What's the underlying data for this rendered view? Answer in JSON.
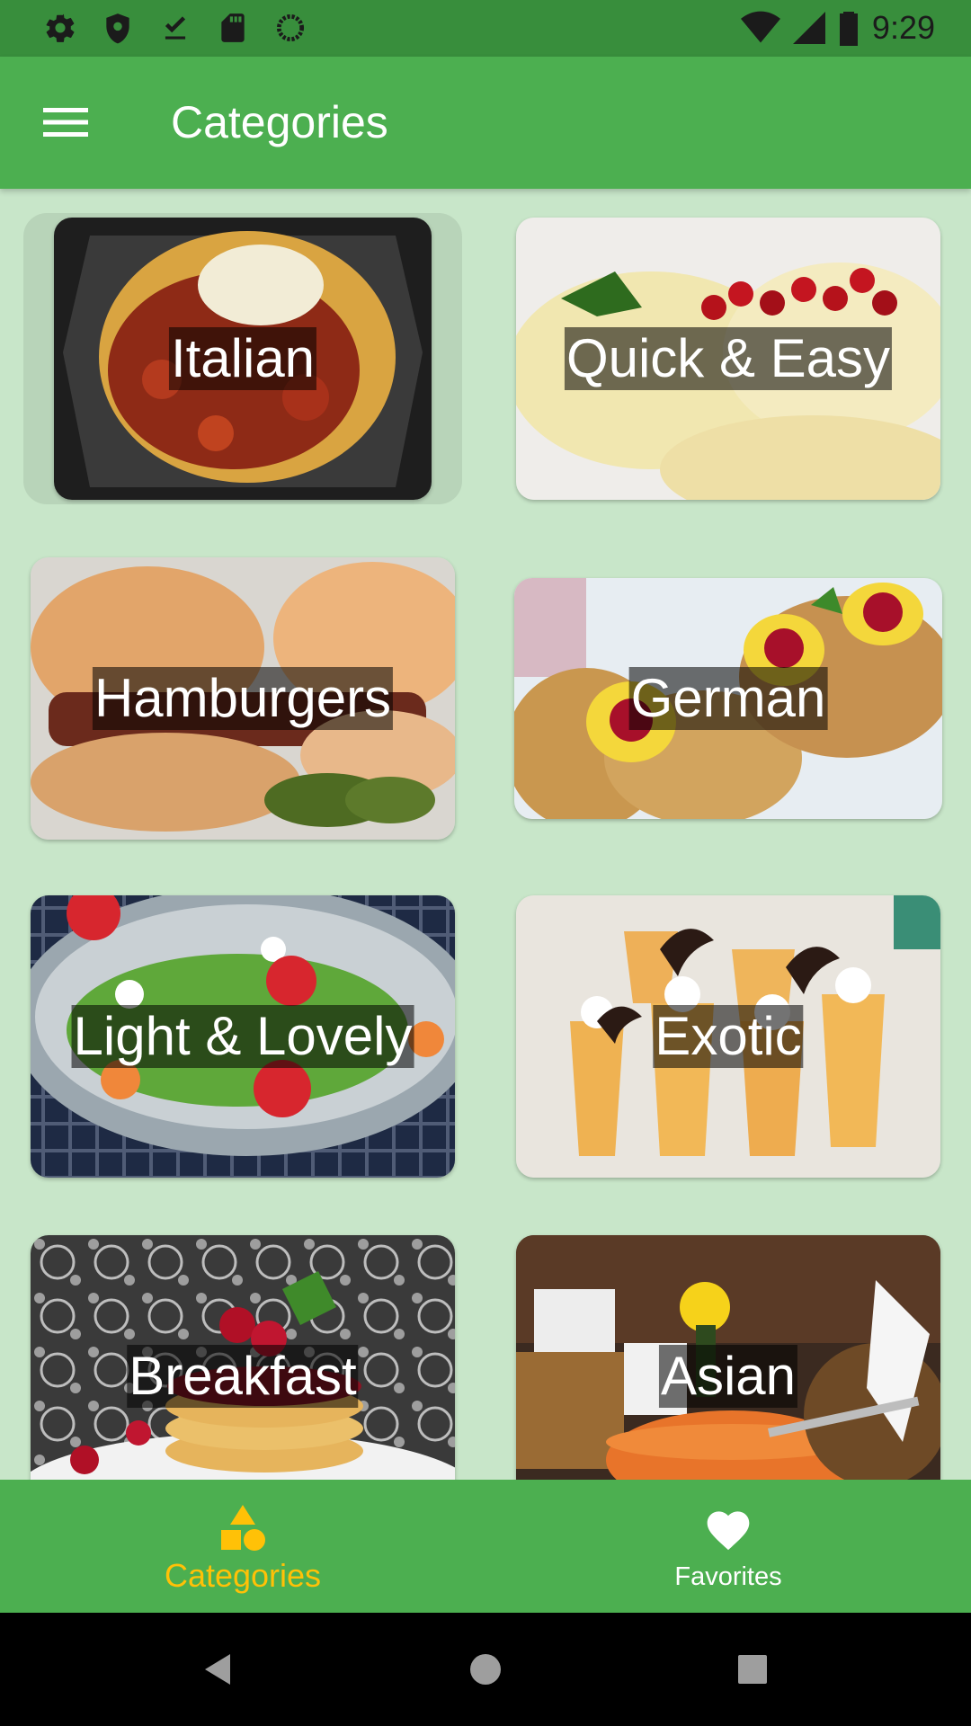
{
  "status_bar": {
    "time": "9:29",
    "left_icons": [
      "settings-icon",
      "shield-icon",
      "download-done-icon",
      "sd-card-icon",
      "sync-circle-icon"
    ],
    "right_icons": [
      "wifi-icon",
      "signal-icon",
      "battery-icon"
    ]
  },
  "app_bar": {
    "title": "Categories",
    "menu_icon": "menu-icon"
  },
  "categories": [
    {
      "label": "Italian"
    },
    {
      "label": "Quick & Easy"
    },
    {
      "label": "Hamburgers"
    },
    {
      "label": "German"
    },
    {
      "label": "Light & Lovely"
    },
    {
      "label": "Exotic"
    },
    {
      "label": "Breakfast"
    },
    {
      "label": "Asian"
    }
  ],
  "bottom_nav": {
    "items": [
      {
        "label": "Categories",
        "icon": "category-icon",
        "active": true
      },
      {
        "label": "Favorites",
        "icon": "heart-icon",
        "active": false
      }
    ]
  },
  "system_nav": [
    "back-icon",
    "home-icon",
    "recents-icon"
  ],
  "colors": {
    "primary": "#4CAF50",
    "primary_dark": "#388E3C",
    "background": "#C8E6C9",
    "accent": "#FFC107"
  }
}
